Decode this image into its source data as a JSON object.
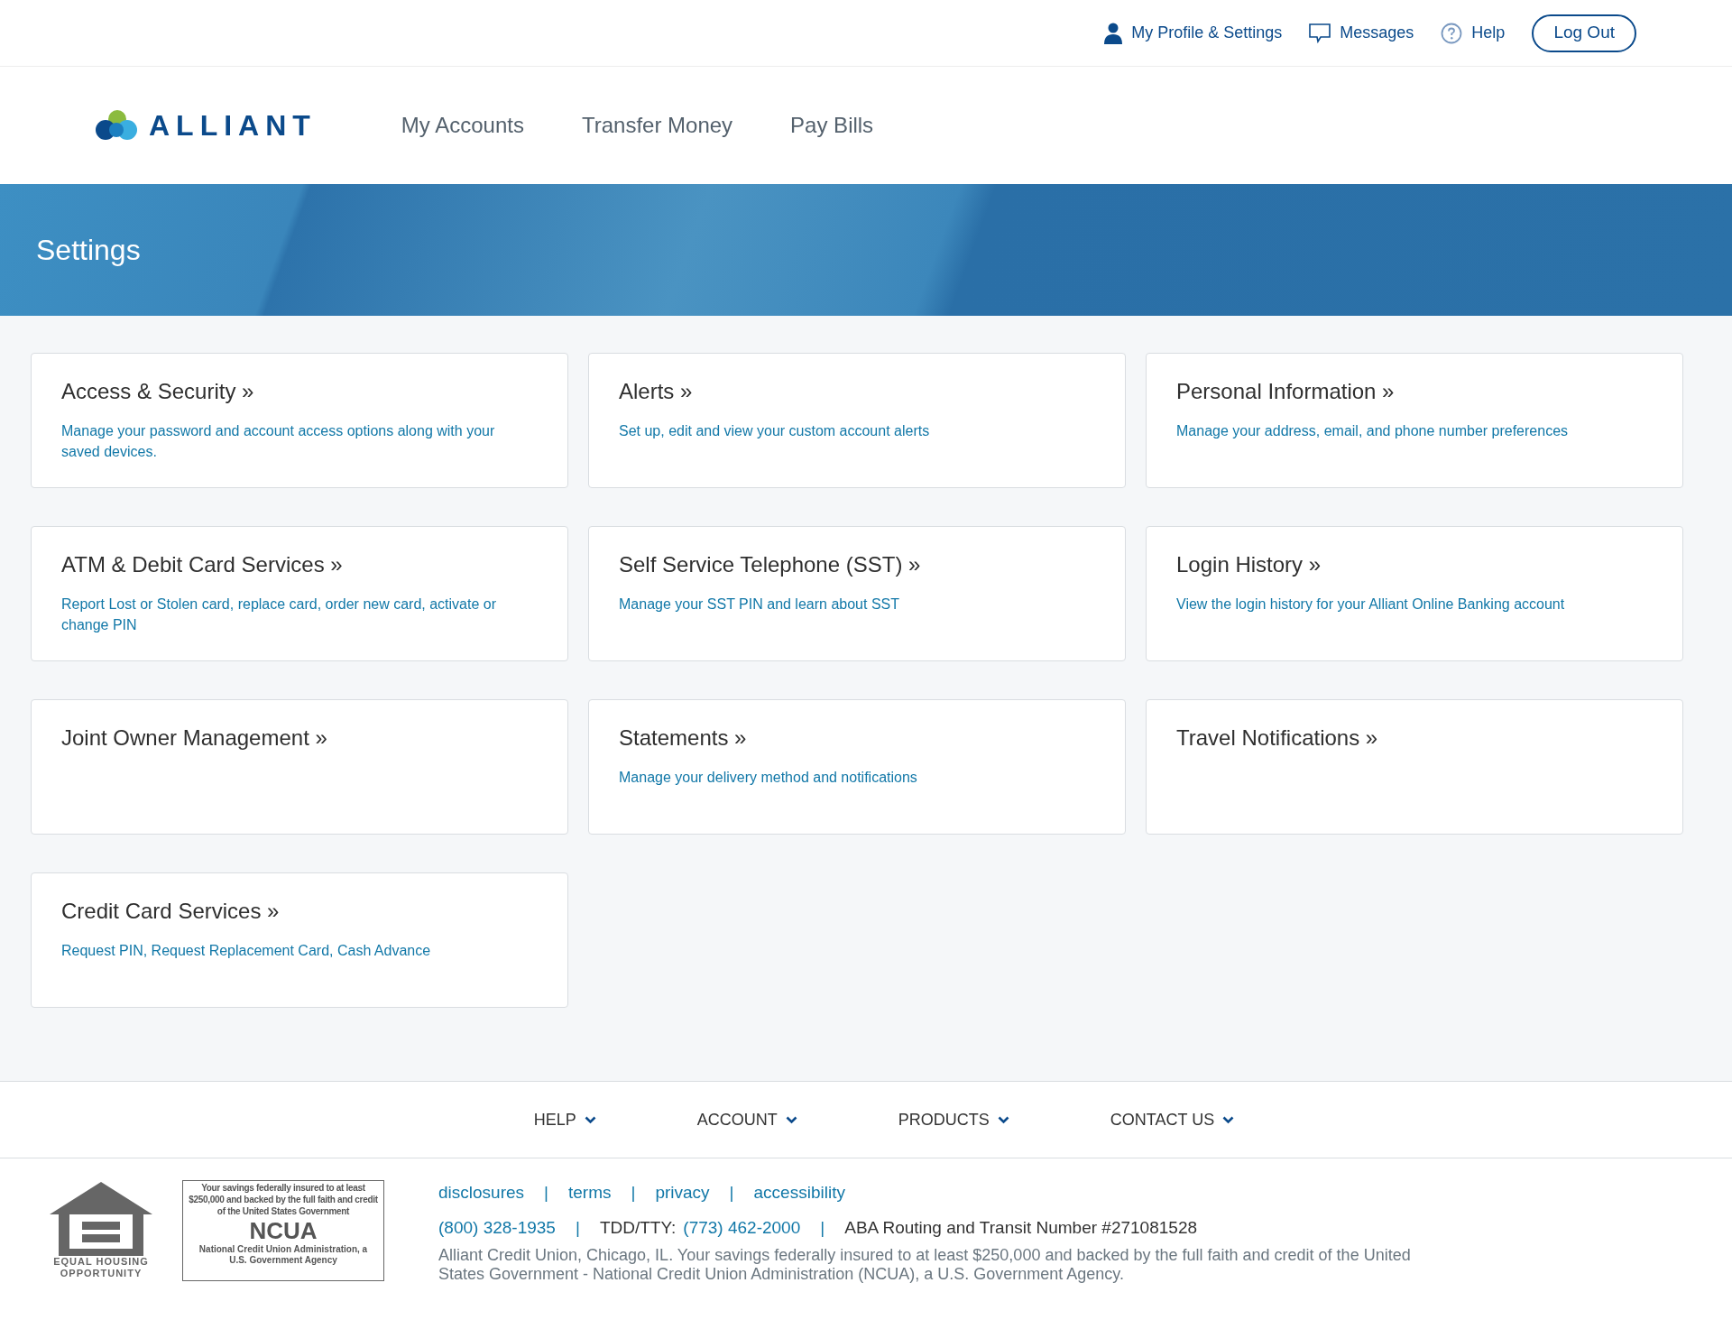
{
  "top_bar": {
    "links": [
      {
        "kind": "profile",
        "label": "My Profile & Settings"
      },
      {
        "kind": "messages",
        "label": "Messages"
      },
      {
        "kind": "help",
        "label": "Help"
      }
    ],
    "logout": "Log Out"
  },
  "header": {
    "logo_text": "ALLIANT",
    "nav": [
      {
        "label": "My Accounts"
      },
      {
        "label": "Transfer Money"
      },
      {
        "label": "Pay Bills"
      }
    ]
  },
  "banner": {
    "title": "Settings"
  },
  "cards": [
    {
      "title": "Access & Security »",
      "description": "Manage your password and account access options along with your saved devices."
    },
    {
      "title": "Alerts »",
      "description": "Set up, edit and view your custom account alerts"
    },
    {
      "title": "Personal Information »",
      "description": "Manage your address, email, and phone number preferences"
    },
    {
      "title": "ATM & Debit Card Services »",
      "description": "Report Lost or Stolen card, replace card, order new card, activate or change PIN"
    },
    {
      "title": "Self Service Telephone (SST) »",
      "description": "Manage your SST PIN and learn about SST"
    },
    {
      "title": "Login History »",
      "description": "View the login history for your Alliant Online Banking account"
    },
    {
      "title": "Joint Owner Management »"
    },
    {
      "title": "Statements »",
      "description": "Manage your delivery method and notifications"
    },
    {
      "title": "Travel Notifications »"
    },
    {
      "title": "Credit Card Services »",
      "description": "Request PIN, Request Replacement Card, Cash Advance"
    }
  ],
  "footer_nav": [
    {
      "label": "HELP"
    },
    {
      "label": "ACCOUNT"
    },
    {
      "label": "PRODUCTS"
    },
    {
      "label": "CONTACT US"
    }
  ],
  "footer": {
    "equal_housing": [
      "EQUAL HOUSING",
      "OPPORTUNITY"
    ],
    "ncua": {
      "top": "Your savings federally insured to at least $250,000 and backed by the full faith and credit of the United States Government",
      "name": "NCUA",
      "bottom": "National Credit Union Administration, a U.S. Government Agency"
    },
    "links": [
      {
        "kind": "link",
        "text": "disclosures"
      },
      {
        "kind": "separator",
        "text": "|"
      },
      {
        "kind": "link",
        "text": "terms"
      },
      {
        "kind": "separator",
        "text": "|"
      },
      {
        "kind": "link",
        "text": "privacy"
      },
      {
        "kind": "separator",
        "text": "|"
      },
      {
        "kind": "link",
        "text": "accessibility"
      }
    ],
    "contact": [
      {
        "kind": "link",
        "text": "(800) 328-1935"
      },
      {
        "kind": "separator",
        "text": "|"
      },
      {
        "kind": "text",
        "text": "TDD/TTY:"
      },
      {
        "kind": "link",
        "text": "(773) 462-2000"
      },
      {
        "kind": "separator",
        "text": "|"
      },
      {
        "kind": "text",
        "text": "ABA Routing and Transit Number #271081528"
      }
    ],
    "legal": "Alliant Credit Union, Chicago, IL. Your savings federally insured to at least $250,000 and backed by the full faith and credit of the United States Government - National Credit Union Administration (NCUA), a U.S. Government Agency."
  }
}
